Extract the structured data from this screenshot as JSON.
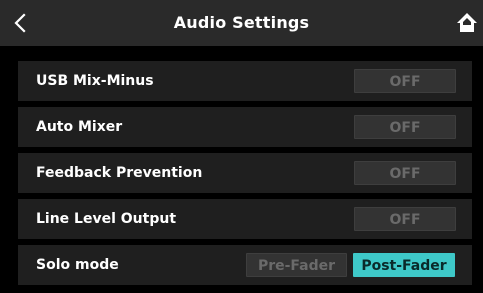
{
  "header": {
    "title": "Audio Settings",
    "back_icon": "chevron-left-icon",
    "home_icon": "home-icon"
  },
  "settings": [
    {
      "label": "USB Mix-Minus",
      "value": "OFF"
    },
    {
      "label": "Auto Mixer",
      "value": "OFF"
    },
    {
      "label": "Feedback Prevention",
      "value": "OFF"
    },
    {
      "label": "Line Level Output",
      "value": "OFF"
    }
  ],
  "solo_mode": {
    "label": "Solo mode",
    "options": [
      "Pre-Fader",
      "Post-Fader"
    ],
    "selected": "Post-Fader"
  },
  "colors": {
    "accent": "#3ec8c8",
    "row_background": "#1f1f1f",
    "header_background": "#2a2a2a",
    "off_button": "#333333"
  }
}
